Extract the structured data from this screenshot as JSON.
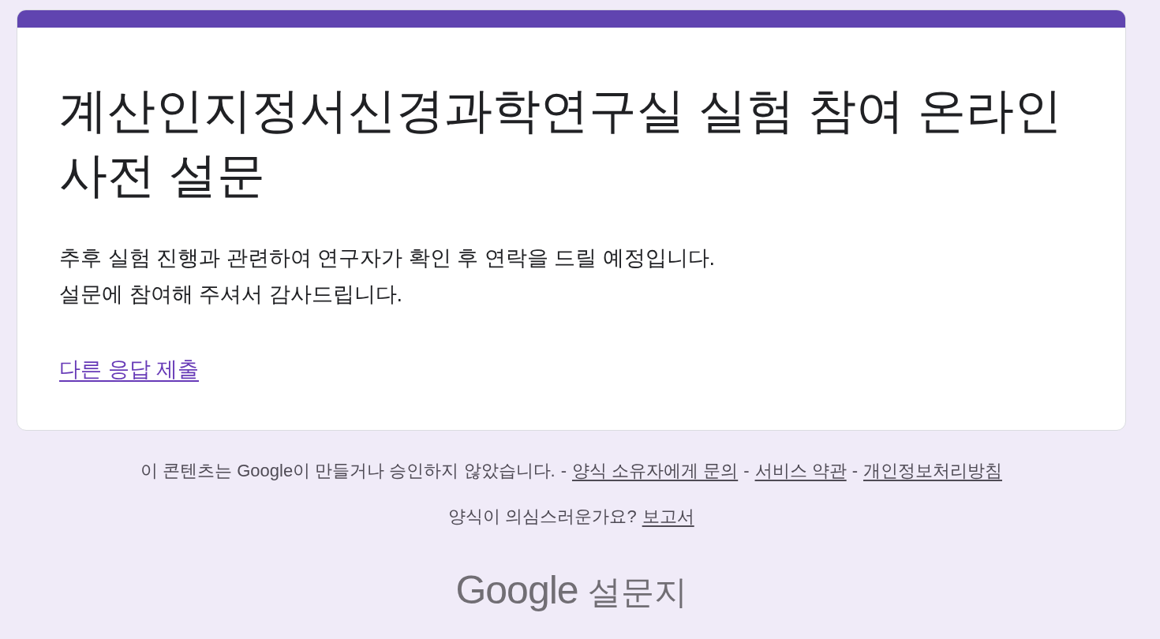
{
  "form": {
    "title": "계산인지정서신경과학연구실 실험 참여 온라인 사전 설문",
    "description_lines": [
      "추후 실험 진행과 관련하여 연구자가 확인 후 연락을 드릴 예정입니다.",
      "설문에 참여해 주셔서 감사드립니다."
    ],
    "another_response_link": "다른 응답 제출"
  },
  "footer": {
    "disclaimer": "이 콘텐츠는 Google이 만들거나 승인하지 않았습니다.",
    "links": [
      {
        "separator": "-",
        "label": "양식 소유자에게 문의"
      },
      {
        "separator": "-",
        "label": "서비스 약관"
      },
      {
        "separator": "-",
        "label": "개인정보처리방침"
      }
    ],
    "report_question": "양식이 의심스러운가요?",
    "report_link": "보고서"
  },
  "logo": {
    "brand": "Google",
    "product": "설문지"
  }
}
